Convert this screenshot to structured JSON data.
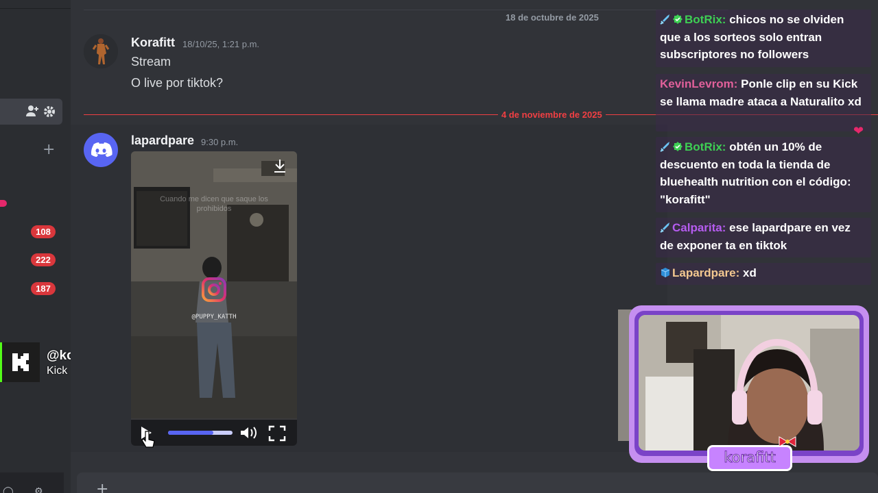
{
  "sidebar": {
    "badges": [
      "108",
      "222",
      "187"
    ]
  },
  "kick_overlay": {
    "handle": "@korafitt",
    "platform": "Kick"
  },
  "chat": {
    "date_separator_old": "18 de octubre de 2025",
    "date_separator_new": "4 de noviembre de 2025",
    "messages": [
      {
        "author": "Korafitt",
        "time": "18/10/25, 1:21 p.m.",
        "lines": [
          "Stream",
          "O live por tiktok?"
        ]
      },
      {
        "author": "lapardpare",
        "time": "9:30 p.m.",
        "video": {
          "caption": "Cuando me dicen que saque los prohibidos",
          "watermark": "@PUPPY_KATTH",
          "progress": 0.7
        }
      }
    ]
  },
  "stream_chat": [
    {
      "badges": [
        "sword-icon",
        "verified-icon"
      ],
      "name": "BotRix",
      "name_color": "#3ecf54",
      "text": "chicos no se olviden que a los sorteos solo entran subscriptores no followers"
    },
    {
      "badges": [],
      "name": "KevinLevrom",
      "name_color": "#e0609a",
      "text": "Ponle clip en su Kick se llama madre ataca a Naturalito xd"
    },
    {
      "badges": [
        "sword-icon",
        "verified-icon"
      ],
      "name": "BotRix",
      "name_color": "#3ecf54",
      "text": "obtén un 10% de descuento en toda la tienda de bluehealth nutrition con el código: \"korafitt\""
    },
    {
      "badges": [
        "sword-icon"
      ],
      "name": "Calparita",
      "name_color": "#b65cf0",
      "text": "ese lapardpare en vez de exponer ta en tiktok"
    },
    {
      "badges": [
        "cube-icon"
      ],
      "name": "Lapardpare",
      "name_color": "#f3c890",
      "text": "xd"
    }
  ],
  "webcam": {
    "label": "korafitt"
  },
  "colors": {
    "accent": "#5865f2",
    "new_messages": "#f23f43",
    "kick_green": "#53fc18",
    "overlay_purple": "#c783ff"
  }
}
